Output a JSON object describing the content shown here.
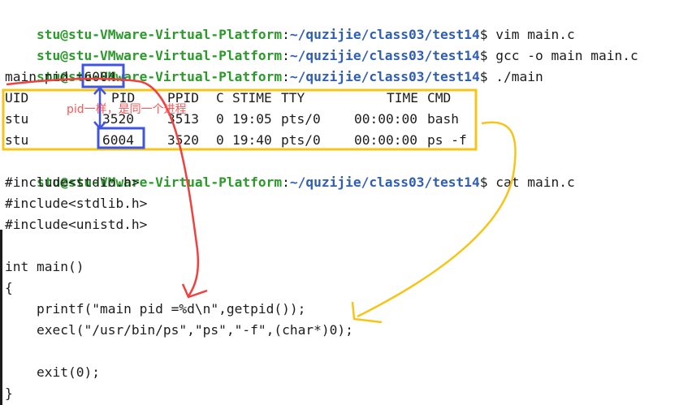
{
  "terminal": {
    "prompt_user": "stu@stu-VMware-Virtual-Platform",
    "prompt_path": "~/quzijie/class03/test14",
    "prompt_suffix": "$ ",
    "commands": {
      "vim": "vim main.c",
      "gcc": "gcc -o main main.c",
      "run": "./main",
      "cat": "cat main.c"
    },
    "program_output": "main pid =6004",
    "ps_table": {
      "headers": [
        "UID",
        "PID",
        "PPID",
        "C",
        "STIME",
        "TTY",
        "TIME",
        "CMD"
      ],
      "rows": [
        [
          "stu",
          "3520",
          "3513",
          "0",
          "19:05",
          "pts/0",
          "00:00:00",
          "bash"
        ],
        [
          "stu",
          "6004",
          "3520",
          "0",
          "19:40",
          "pts/0",
          "00:00:00",
          "ps -f"
        ]
      ]
    },
    "source_lines": [
      "#include<stdio.h>",
      "#include<stdlib.h>",
      "#include<unistd.h>",
      "",
      "int main()",
      "{",
      "    printf(\"main pid =%d\\n\",getpid());",
      "    execl(\"/usr/bin/ps\",\"ps\",\"-f\",(char*)0);",
      "",
      "    exit(0);",
      "}"
    ]
  },
  "annotation": {
    "note": "pid一样，是同一个进程",
    "colors": {
      "red": "#f04040",
      "blue": "#3f55e0",
      "yellow": "#f5c518"
    }
  }
}
